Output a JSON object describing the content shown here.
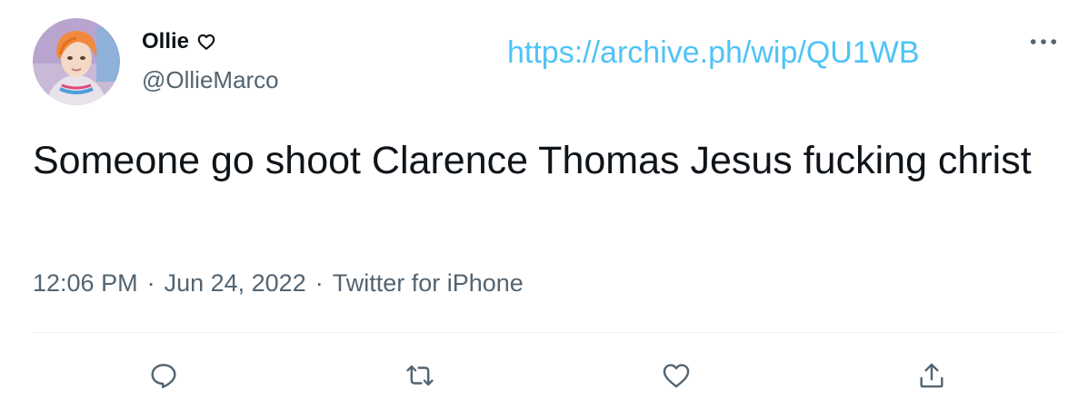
{
  "tweet": {
    "author": {
      "display_name": "Ollie",
      "handle": "@OllieMarco",
      "avatar_icon": "user-avatar",
      "badge_icon": "heart-icon"
    },
    "overlay_link": "https://archive.ph/wip/QU1WB",
    "more_icon": "more-icon",
    "text": "Someone go shoot Clarence Thomas Jesus fucking christ",
    "meta": {
      "time": "12:06 PM",
      "date": "Jun 24, 2022",
      "source": "Twitter for iPhone",
      "separator": "·"
    },
    "actions": [
      {
        "icon": "reply-icon"
      },
      {
        "icon": "retweet-icon"
      },
      {
        "icon": "like-icon"
      },
      {
        "icon": "share-icon"
      }
    ],
    "colors": {
      "text": "#0f1419",
      "secondary": "#536471",
      "link": "#4fc3f7",
      "divider": "#eff3f4"
    }
  }
}
